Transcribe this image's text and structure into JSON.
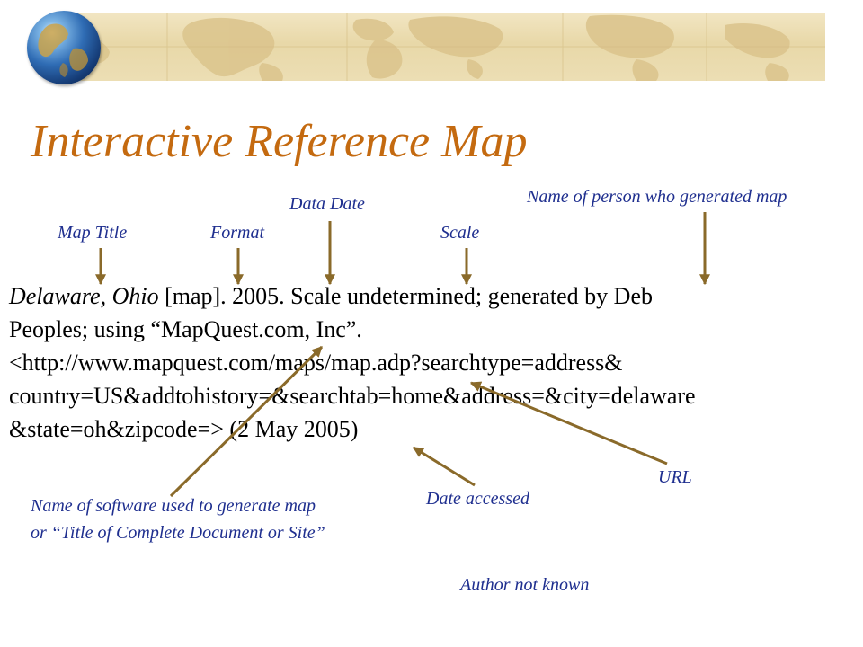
{
  "title": "Interactive Reference Map",
  "labels": {
    "map_title": "Map Title",
    "format": "Format",
    "data_date": "Data Date",
    "scale": "Scale",
    "person": "Name of person who generated map",
    "software_line1": "Name of software used to generate map",
    "software_line2": "or “Title of Complete Document or Site”",
    "date_accessed": "Date accessed",
    "url": "URL",
    "author": "Author not known"
  },
  "citation": {
    "place": "Delaware, Ohio",
    "line1_rest": " [map].  2005.  Scale undetermined; generated by Deb",
    "line2": "Peoples; using  “MapQuest.com, Inc”.",
    "line3": "<http://www.mapquest.com/maps/map.adp?searchtype=address&",
    "line4": "country=US&addtohistory=&searchtab=home&address=&city=delaware",
    "line5": "&state=oh&zipcode=> (2 May 2005)"
  },
  "colors": {
    "title": "#c46a10",
    "annotation": "#1f2f8f",
    "arrow": "#8a6a2a",
    "parchment": "#ecdeb4"
  },
  "icons": {
    "banner": "world-map-banner",
    "globe": "globe-icon"
  }
}
